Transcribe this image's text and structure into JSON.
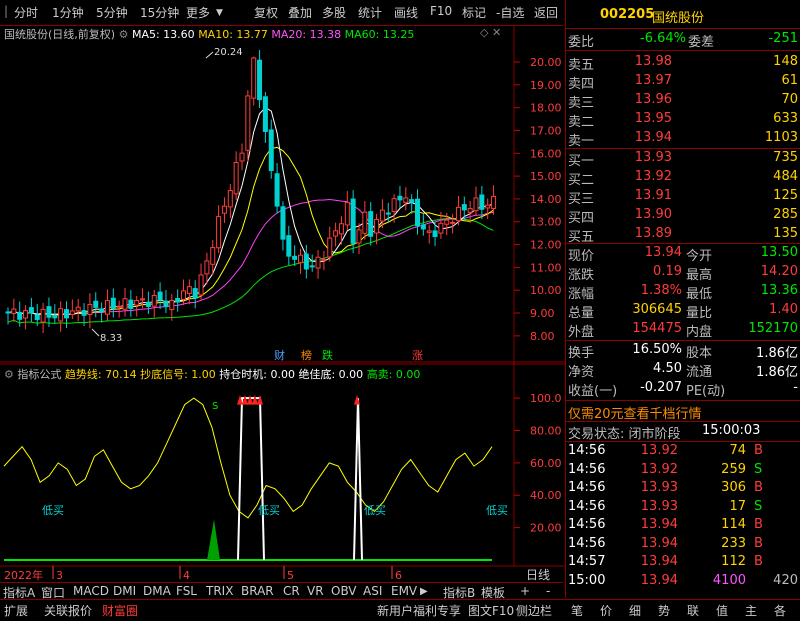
{
  "toolbar": {
    "left": [
      "分时",
      "1分钟",
      "5分钟",
      "15分钟",
      "更多"
    ],
    "right": [
      "复权",
      "叠加",
      "多股",
      "统计",
      "画线",
      "F10",
      "标记",
      "-自选",
      "返回"
    ]
  },
  "chart_header": {
    "name": "国统股份(日线,前复权)",
    "ma5": "MA5: 13.60",
    "ma10": "MA10: 13.77",
    "ma20": "MA20: 13.38",
    "ma60": "MA60: 13.25"
  },
  "chart_annotations": {
    "high": "20.24",
    "low": "8.33"
  },
  "event_tags": [
    "财",
    "榜",
    "跌",
    "涨"
  ],
  "indicator_header": {
    "name": "指标公式",
    "trend": "趋势线: 70.14",
    "bottom_signal": "抄底信号: 1.00",
    "hold": "持仓时机: 0.00",
    "abs_bottom": "绝佳底: 0.00",
    "high_sell": "高卖: 0.00"
  },
  "low_buy_labels": [
    "低买",
    "低买",
    "低买",
    "低买"
  ],
  "x_axis": {
    "year": "2022年",
    "months": [
      "3",
      "4",
      "5",
      "6"
    ],
    "right_label": "日线"
  },
  "chart_data": {
    "type": "candlestick",
    "price_axis_ticks": [
      "20.00",
      "19.00",
      "18.00",
      "17.00",
      "16.00",
      "15.00",
      "14.00",
      "13.00",
      "12.00",
      "11.00",
      "10.00",
      "9.00",
      "8.00"
    ],
    "ylim": [
      7.6,
      20.7
    ],
    "indicator_axis_ticks": [
      "100.0",
      "80.00",
      "60.00",
      "40.00",
      "20.00"
    ],
    "indicator_ylim": [
      0,
      105
    ],
    "series_names": [
      "MA5",
      "MA10",
      "MA20",
      "MA60"
    ],
    "colors": {
      "MA5": "#ffffff",
      "MA10": "#ffff00",
      "MA20": "#ff40ff",
      "MA60": "#00e600",
      "trend": "#ffff00"
    },
    "high_annotation": 20.24,
    "low_annotation": 8.33
  },
  "quote": {
    "code": "002205",
    "name": "国统股份",
    "weibi_label": "委比",
    "weibi": "-6.64%",
    "weicha_label": "委差",
    "weicha": "-251",
    "sells": [
      {
        "label": "卖五",
        "price": "13.98",
        "vol": "148"
      },
      {
        "label": "卖四",
        "price": "13.97",
        "vol": "61"
      },
      {
        "label": "卖三",
        "price": "13.96",
        "vol": "70"
      },
      {
        "label": "卖二",
        "price": "13.95",
        "vol": "633"
      },
      {
        "label": "卖一",
        "price": "13.94",
        "vol": "1103"
      }
    ],
    "buys": [
      {
        "label": "买一",
        "price": "13.93",
        "vol": "735"
      },
      {
        "label": "买二",
        "price": "13.92",
        "vol": "484"
      },
      {
        "label": "买三",
        "price": "13.91",
        "vol": "125"
      },
      {
        "label": "买四",
        "price": "13.90",
        "vol": "285"
      },
      {
        "label": "买五",
        "price": "13.89",
        "vol": "135"
      }
    ],
    "stats": [
      {
        "l1": "现价",
        "v1": "13.94",
        "c1": "red",
        "l2": "今开",
        "v2": "13.50",
        "c2": "grn"
      },
      {
        "l1": "涨跌",
        "v1": "0.19",
        "c1": "red",
        "l2": "最高",
        "v2": "14.20",
        "c2": "red"
      },
      {
        "l1": "涨幅",
        "v1": "1.38%",
        "c1": "red",
        "l2": "最低",
        "v2": "13.36",
        "c2": "grn"
      },
      {
        "l1": "总量",
        "v1": "306645",
        "c1": "yel",
        "l2": "量比",
        "v2": "1.40",
        "c2": "red"
      },
      {
        "l1": "外盘",
        "v1": "154475",
        "c1": "red",
        "l2": "内盘",
        "v2": "152170",
        "c2": "grn"
      }
    ],
    "stats2": [
      {
        "l1": "换手",
        "v1": "16.50%",
        "l2": "股本",
        "v2": "1.86亿"
      },
      {
        "l1": "净资",
        "v1": "4.50",
        "l2": "流通",
        "v2": "1.86亿"
      },
      {
        "l1": "收益(一)",
        "v1": "-0.207",
        "l2": "PE(动)",
        "v2": "-"
      }
    ],
    "promo": "仅需20元查看千档行情",
    "trade_status_label": "交易状态: 闭市阶段",
    "trade_status_time": "15:00:03",
    "ticks": [
      {
        "t": "14:56",
        "p": "13.92",
        "v": "74",
        "f": "B",
        "fc": "red"
      },
      {
        "t": "14:56",
        "p": "13.92",
        "v": "259",
        "f": "S",
        "fc": "grn"
      },
      {
        "t": "14:56",
        "p": "13.93",
        "v": "306",
        "f": "B",
        "fc": "red"
      },
      {
        "t": "14:56",
        "p": "13.93",
        "v": "17",
        "f": "S",
        "fc": "grn"
      },
      {
        "t": "14:56",
        "p": "13.94",
        "v": "114",
        "f": "B",
        "fc": "red"
      },
      {
        "t": "14:56",
        "p": "13.94",
        "v": "233",
        "f": "B",
        "fc": "red"
      },
      {
        "t": "14:57",
        "p": "13.94",
        "v": "112",
        "f": "B",
        "fc": "red"
      },
      {
        "t": "15:00",
        "p": "13.94",
        "v": "4100",
        "f": "420",
        "fc": "gray"
      }
    ]
  },
  "tabs": [
    "指标A",
    "窗口",
    "MACD",
    "DMI",
    "DMA",
    "FSL",
    "TRIX",
    "BRAR",
    "CR",
    "VR",
    "OBV",
    "ASI",
    "EMV",
    "指标B",
    "模板",
    "+",
    "-"
  ],
  "status_left": [
    "扩展",
    "关联报价",
    "财富圈"
  ],
  "status_mid": [
    "新用户福利专享",
    "图文F10",
    "侧边栏"
  ],
  "status_right": [
    "笔",
    "价",
    "细",
    "势",
    "联",
    "值",
    "主",
    "各"
  ]
}
